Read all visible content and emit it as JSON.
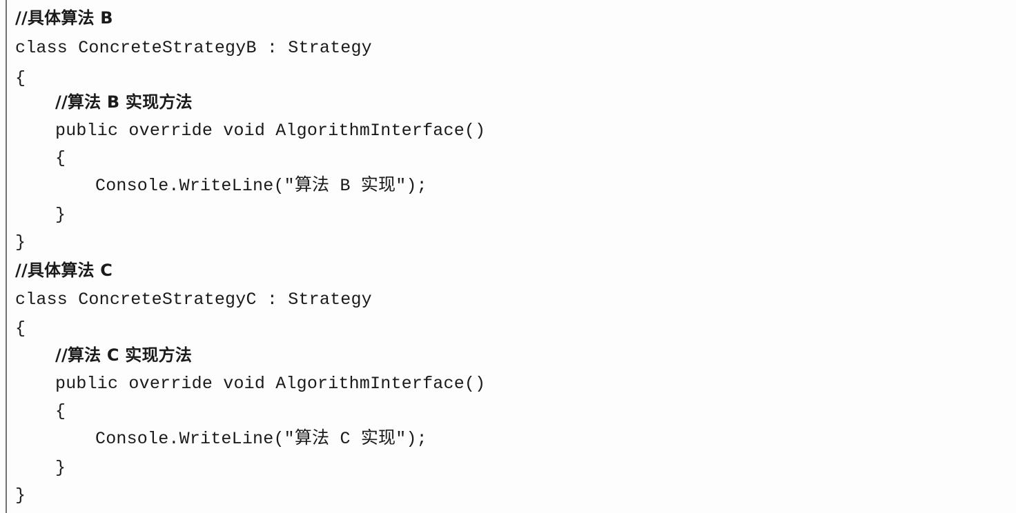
{
  "document": {
    "lines": [
      "//具体算法 B",
      "class ConcreteStrategyB : Strategy",
      "{",
      "//算法 B 实现方法",
      "public override void AlgorithmInterface()",
      "{",
      "Console.WriteLine(\"算法 B 实现\");",
      "}",
      "}",
      "//具体算法 C",
      "class ConcreteStrategyC : Strategy",
      "{",
      "//算法 C 实现方法",
      "public override void AlgorithmInterface()",
      "{",
      "Console.WriteLine(\"算法 C 实现\");",
      "}",
      "}"
    ]
  }
}
